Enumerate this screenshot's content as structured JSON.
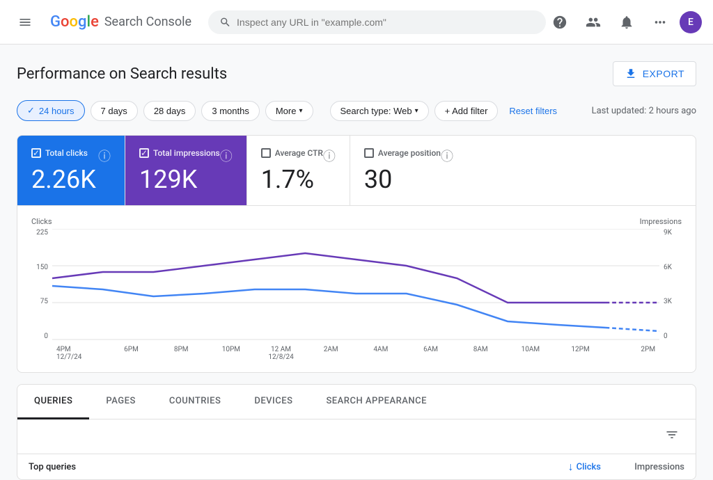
{
  "header": {
    "menu_icon": "☰",
    "logo_google": "Google",
    "logo_sc": "Search Console",
    "search_placeholder": "Inspect any URL in \"example.com\"",
    "help_icon": "?",
    "users_icon": "👤",
    "notification_icon": "🔔",
    "apps_icon": "⋮⋮⋮",
    "avatar_letter": "E"
  },
  "page": {
    "title": "Performance on Search results",
    "export_label": "EXPORT"
  },
  "filters": {
    "hours": "24 hours",
    "days7": "7 days",
    "days28": "28 days",
    "months3": "3 months",
    "more": "More",
    "search_type_label": "Search type: Web",
    "add_filter_label": "+ Add filter",
    "reset_label": "Reset filters",
    "last_updated": "Last updated: 2 hours ago"
  },
  "metrics": [
    {
      "id": "total-clicks",
      "label": "Total clicks",
      "value": "2.26K",
      "type": "active-blue",
      "checked": true
    },
    {
      "id": "total-impressions",
      "label": "Total impressions",
      "value": "129K",
      "type": "active-purple",
      "checked": true
    },
    {
      "id": "average-ctr",
      "label": "Average CTR",
      "value": "1.7%",
      "type": "inactive",
      "checked": false
    },
    {
      "id": "average-position",
      "label": "Average position",
      "value": "30",
      "type": "inactive",
      "checked": false
    }
  ],
  "chart": {
    "y_axis_left": {
      "label": "Clicks",
      "ticks": [
        "225",
        "150",
        "75",
        "0"
      ]
    },
    "y_axis_right": {
      "label": "Impressions",
      "ticks": [
        "9K",
        "6K",
        "3K",
        "0"
      ]
    },
    "x_axis_labels": [
      "4PM\n12/7/24",
      "6PM",
      "8PM",
      "10PM",
      "12 AM\n12/8/24",
      "2AM",
      "4AM",
      "6AM",
      "8AM",
      "10AM",
      "12PM",
      "2PM"
    ]
  },
  "tabs": {
    "items": [
      {
        "id": "queries",
        "label": "QUERIES",
        "active": true
      },
      {
        "id": "pages",
        "label": "PAGES",
        "active": false
      },
      {
        "id": "countries",
        "label": "COUNTRIES",
        "active": false
      },
      {
        "id": "devices",
        "label": "DEVICES",
        "active": false
      },
      {
        "id": "search-appearance",
        "label": "SEARCH APPEARANCE",
        "active": false
      }
    ]
  },
  "table": {
    "col_query": "Top queries",
    "col_clicks": "Clicks",
    "col_impressions": "Impressions"
  }
}
